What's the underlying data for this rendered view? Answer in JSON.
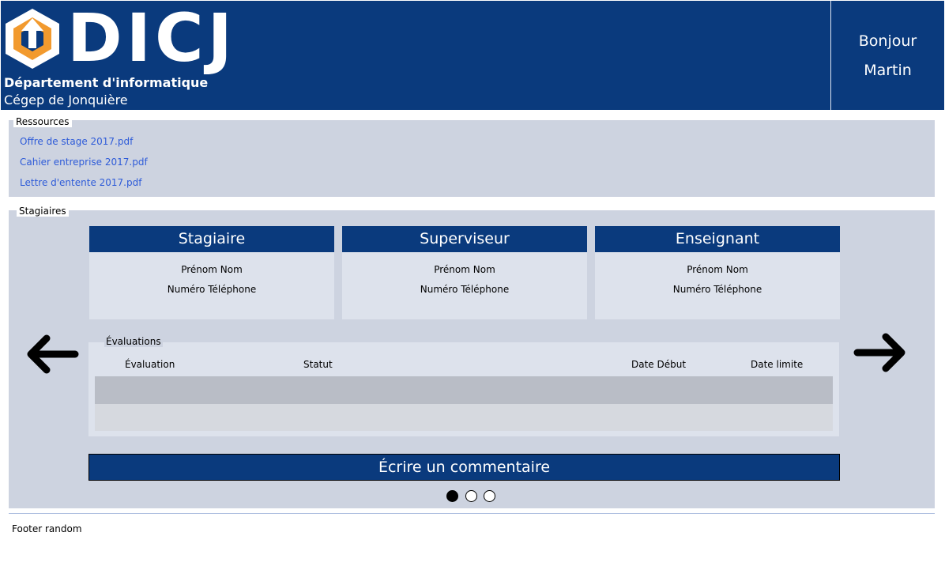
{
  "header": {
    "logo_text": "DICJ",
    "department": "Département d'informatique",
    "college": "Cégep de Jonquière",
    "greeting": "Bonjour",
    "user_name": "Martin"
  },
  "ressources": {
    "legend": "Ressources",
    "links": [
      "Offre de stage 2017.pdf",
      "Cahier entreprise 2017.pdf",
      "Lettre d'entente 2017.pdf"
    ]
  },
  "stagiaires": {
    "legend": "Stagiaires",
    "cards": [
      {
        "title": "Stagiaire",
        "name": "Prénom Nom",
        "phone": "Numéro Téléphone"
      },
      {
        "title": "Superviseur",
        "name": "Prénom Nom",
        "phone": "Numéro Téléphone"
      },
      {
        "title": "Enseignant",
        "name": "Prénom Nom",
        "phone": "Numéro Téléphone"
      }
    ],
    "evaluations": {
      "legend": "Évaluations",
      "columns": [
        "Évaluation",
        "Statut",
        "Date Début",
        "Date limite"
      ]
    },
    "comment_button": "Écrire un commentaire",
    "carousel": {
      "total": 3,
      "active": 1
    },
    "icons": {
      "prev": "arrow-left-icon",
      "next": "arrow-right-icon"
    }
  },
  "footer": {
    "text": "Footer random"
  },
  "colors": {
    "brand": "#0a3a7d",
    "panel": "#cdd3e0",
    "card": "#dde2ec",
    "link": "#2e5bd8",
    "logo_orange": "#f29a2e"
  }
}
